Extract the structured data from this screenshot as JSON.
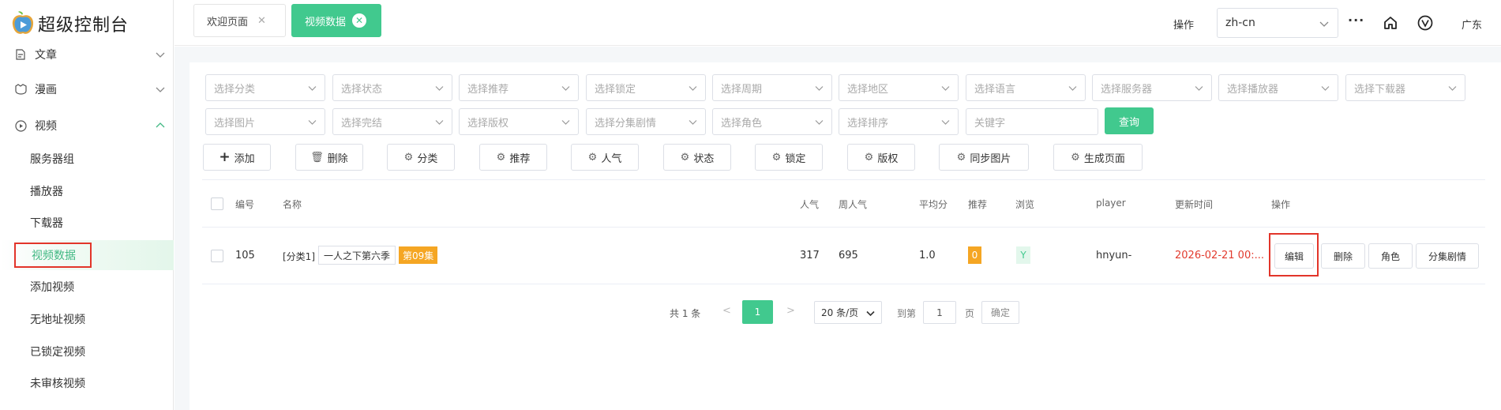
{
  "app": {
    "title": "超级控制台"
  },
  "sidebar": {
    "groups": [
      {
        "label": "文章",
        "icon": "document-icon",
        "expanded": false
      },
      {
        "label": "漫画",
        "icon": "comic-icon",
        "expanded": false
      },
      {
        "label": "视频",
        "icon": "video-icon",
        "expanded": true
      }
    ],
    "items": [
      {
        "label": "服务器组"
      },
      {
        "label": "播放器"
      },
      {
        "label": "下载器"
      },
      {
        "label": "视频数据",
        "active": true
      },
      {
        "label": "添加视频"
      },
      {
        "label": "无地址视频"
      },
      {
        "label": "已锁定视频"
      },
      {
        "label": "未审核视频"
      }
    ]
  },
  "header": {
    "tabs": [
      {
        "label": "欢迎页面",
        "active": false
      },
      {
        "label": "视频数据",
        "active": true
      }
    ],
    "operation_label": "操作",
    "language": "zh-cn",
    "more": "···",
    "region": "广东"
  },
  "filters": {
    "row1": [
      "选择分类",
      "选择状态",
      "选择推荐",
      "选择锁定",
      "选择周期",
      "选择地区",
      "选择语言",
      "选择服务器",
      "选择播放器",
      "选择下载器"
    ],
    "row2": [
      "选择图片",
      "选择完结",
      "选择版权",
      "选择分集剧情",
      "选择角色",
      "选择排序"
    ],
    "keyword_placeholder": "关键字",
    "query_label": "查询"
  },
  "actions": [
    {
      "label": "添加",
      "icon": "plus-icon"
    },
    {
      "label": "删除",
      "icon": "trash-icon"
    },
    {
      "label": "分类",
      "icon": "gear-icon"
    },
    {
      "label": "推荐",
      "icon": "gear-icon"
    },
    {
      "label": "人气",
      "icon": "gear-icon"
    },
    {
      "label": "状态",
      "icon": "gear-icon"
    },
    {
      "label": "锁定",
      "icon": "gear-icon"
    },
    {
      "label": "版权",
      "icon": "gear-icon"
    },
    {
      "label": "同步图片",
      "icon": "gear-icon"
    },
    {
      "label": "生成页面",
      "icon": "gear-icon"
    }
  ],
  "table": {
    "columns": [
      "编号",
      "名称",
      "人气",
      "周人气",
      "平均分",
      "推荐",
      "浏览",
      "player",
      "更新时间",
      "操作"
    ],
    "rows": [
      {
        "id": "105",
        "category": "[分类1]",
        "name": "一人之下第六季",
        "episode": "第09集",
        "hits": "317",
        "week_hits": "695",
        "score": "1.0",
        "recommend": "0",
        "browse": "Y",
        "player": "hnyun-",
        "updated": "2026-02-21 00:...",
        "ops": [
          "编辑",
          "删除",
          "角色",
          "分集剧情"
        ]
      }
    ]
  },
  "pagination": {
    "total": "共 1 条",
    "prev": "<",
    "current": "1",
    "next": ">",
    "page_size": "20 条/页",
    "goto_label": "到第",
    "goto_value": "1",
    "page_label": "页",
    "confirm": "确定"
  },
  "colors": {
    "accent": "#41c98e",
    "highlight_border": "#e2352a",
    "badge_orange": "#f5a623",
    "time_red": "#e23b2e"
  }
}
